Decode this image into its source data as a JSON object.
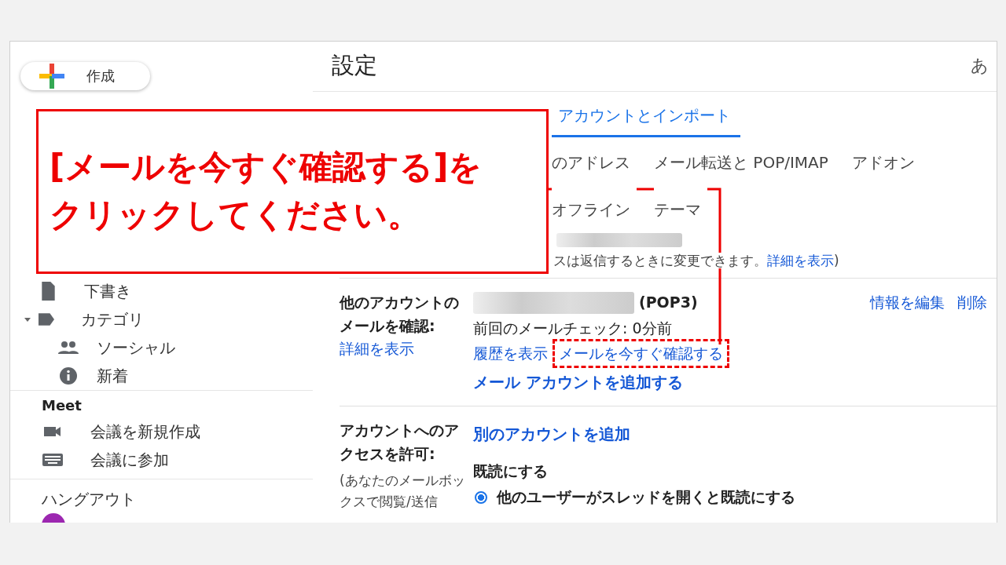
{
  "sidebar": {
    "compose": "作成",
    "items": [
      {
        "kind": "draft",
        "label": "下書き"
      },
      {
        "kind": "label",
        "label": "カテゴリ",
        "expanded": true,
        "children": [
          {
            "kind": "people",
            "label": "ソーシャル"
          },
          {
            "kind": "info",
            "label": "新着"
          }
        ]
      }
    ],
    "meet": {
      "title": "Meet",
      "items": [
        {
          "kind": "video",
          "label": "会議を新規作成"
        },
        {
          "kind": "keyboard",
          "label": "会議に参加"
        }
      ]
    },
    "hangouts": {
      "title": "ハングアウト"
    }
  },
  "main": {
    "title": "設定",
    "input_tool": "あ",
    "tabs": [
      [
        {
          "label": "アカウントとインポート",
          "selected": true
        }
      ],
      [
        {
          "label": "のアドレス",
          "selected": false
        },
        {
          "label": "メール転送と POP/IMAP",
          "selected": false
        },
        {
          "label": "アドオン",
          "selected": false
        }
      ],
      [
        {
          "label": "オフライン",
          "selected": false
        },
        {
          "label": "テーマ",
          "selected": false
        }
      ]
    ],
    "note": {
      "text": "スは返信するときに変更できます。",
      "link": "詳細を表示",
      "close": ")"
    },
    "check_mail": {
      "label": "他のアカウントのメールを確認:",
      "label_link": "詳細を表示",
      "protocol": "(POP3)",
      "last_check": "前回のメールチェック: 0分前",
      "history_link": "履歴を表示",
      "check_now_link": "メールを今すぐ確認する",
      "add_link": "メール アカウントを追加する",
      "edit_link": "情報を編集",
      "delete_link": "削除"
    },
    "grant_access": {
      "label": "アカウントへのアクセスを許可:",
      "hint": "(あなたのメールボックスで閲覧/送信",
      "add_link": "別のアカウントを追加",
      "mark_read": "既読にする",
      "options": [
        {
          "label": "他のユーザーがスレッドを開くと既読にする",
          "selected": true
        }
      ]
    }
  },
  "callout": {
    "text": "[メールを今すぐ確認する]をクリックしてください。"
  }
}
